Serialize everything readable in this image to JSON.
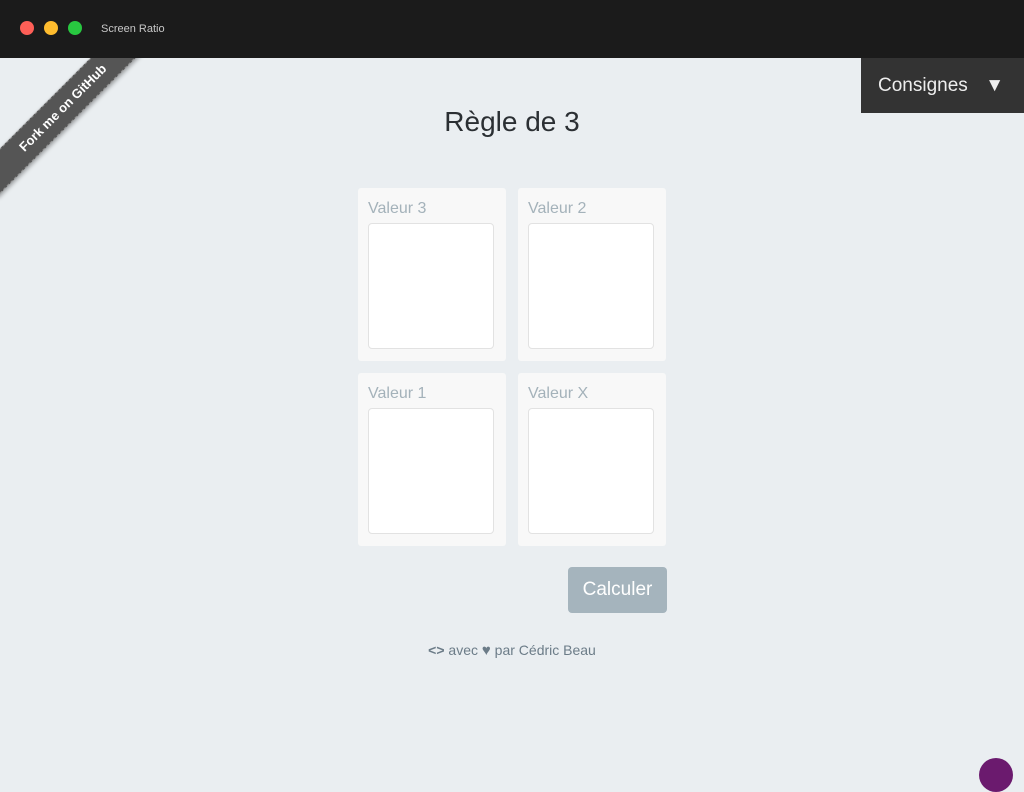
{
  "window": {
    "title": "Screen Ratio"
  },
  "ribbon": {
    "label": "Fork me on GitHub"
  },
  "consignes": {
    "label": "Consignes",
    "arrow": "▼"
  },
  "page": {
    "title": "Règle de 3"
  },
  "cards": [
    {
      "label": "Valeur 3",
      "value": ""
    },
    {
      "label": "Valeur 2",
      "value": ""
    },
    {
      "label": "Valeur 1",
      "value": ""
    },
    {
      "label": "Valeur X",
      "value": ""
    }
  ],
  "actions": {
    "calculate_label": "Calculer"
  },
  "footer": {
    "code": "<>",
    "avec": "avec",
    "heart": "♥",
    "par": "par Cédric Beau"
  },
  "colors": {
    "accent_button": "#a5b4bd",
    "background": "#eaeef1",
    "header": "#1b1b1b"
  }
}
